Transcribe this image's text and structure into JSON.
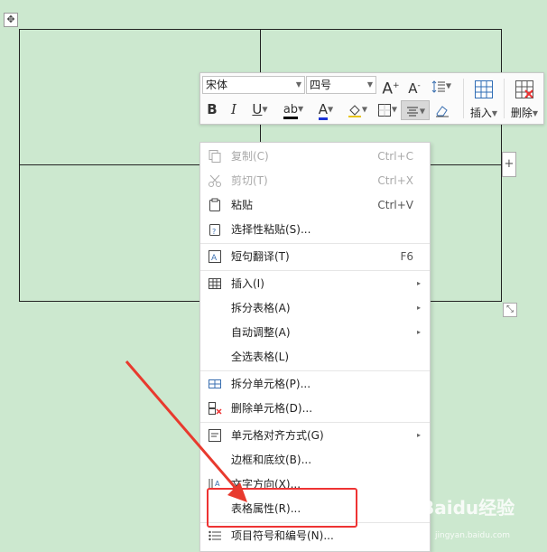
{
  "toolbar": {
    "font_name": "宋体",
    "font_size": "四号",
    "grow_font": "A",
    "shrink_font": "A",
    "bold": "B",
    "italic": "I",
    "underline": "U",
    "font_color": "A",
    "insert_label": "插入",
    "delete_label": "删除"
  },
  "menu": {
    "copy": {
      "label": "复制(C)",
      "shortcut": "Ctrl+C"
    },
    "cut": {
      "label": "剪切(T)",
      "shortcut": "Ctrl+X"
    },
    "paste": {
      "label": "粘贴",
      "shortcut": "Ctrl+V"
    },
    "paste_special": {
      "label": "选择性粘贴(S)..."
    },
    "translate": {
      "label": "短句翻译(T)",
      "shortcut": "F6"
    },
    "insert": {
      "label": "插入(I)"
    },
    "split_table": {
      "label": "拆分表格(A)"
    },
    "auto_fit": {
      "label": "自动调整(A)"
    },
    "select_table": {
      "label": "全选表格(L)"
    },
    "split_cells": {
      "label": "拆分单元格(P)..."
    },
    "delete_cells": {
      "label": "删除单元格(D)..."
    },
    "cell_align": {
      "label": "单元格对齐方式(G)"
    },
    "borders": {
      "label": "边框和底纹(B)..."
    },
    "text_direction": {
      "label": "文字方向(X)..."
    },
    "table_props": {
      "label": "表格属性(R)..."
    },
    "bullets": {
      "label": "项目符号和编号(N)..."
    }
  },
  "watermark": {
    "text": "Baidu经验",
    "sub": "jingyan.baidu.com"
  },
  "colors": {
    "background": "#cce8cf",
    "annotation": "#e33333"
  }
}
